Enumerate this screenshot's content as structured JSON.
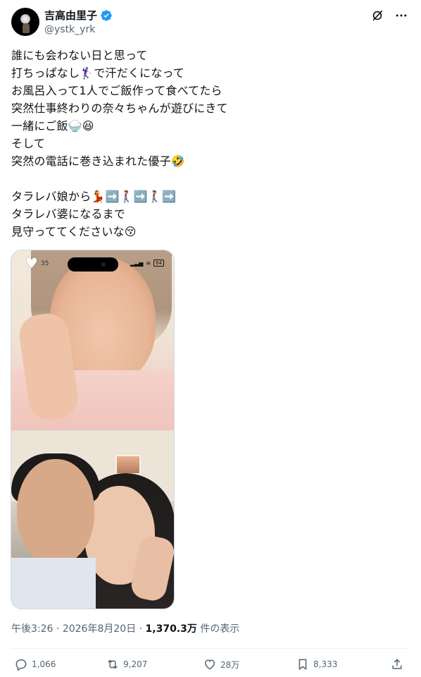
{
  "user": {
    "display_name": "吉高由里子",
    "handle": "@ystk_yrk"
  },
  "post": {
    "lines": [
      "誰にも会わない日と思って",
      "打ちっぱなし🏌️‍♀️で汗だくになって",
      "お風呂入って1人でご飯作って食べてたら",
      "突然仕事終わりの奈々ちゃんが遊びにきて",
      "一緒にご飯🍚😆",
      "そして",
      "突然の電話に巻き込まれた優子🤣",
      "",
      "タラレバ娘から💃➡️🚶‍♀️➡️🚶‍♀️➡️",
      "タラレバ婆になるまで",
      "見守っててくださいな😚"
    ]
  },
  "media": {
    "heart_count": "35",
    "battery": "64"
  },
  "meta": {
    "time": "午後3:26",
    "date": "2026年8月20日",
    "views": "1,370.3万",
    "views_label": "件の表示"
  },
  "actions": {
    "replies": "1,066",
    "reposts": "9,207",
    "likes": "28万",
    "bookmarks": "8,333"
  },
  "icons": [
    "verified-badge-icon",
    "grok-icon",
    "more-icon",
    "reply-icon",
    "repost-icon",
    "like-icon",
    "bookmark-icon",
    "share-icon"
  ],
  "colors": {
    "verified": "#1d9bf0",
    "secondary_text": "#536471"
  }
}
